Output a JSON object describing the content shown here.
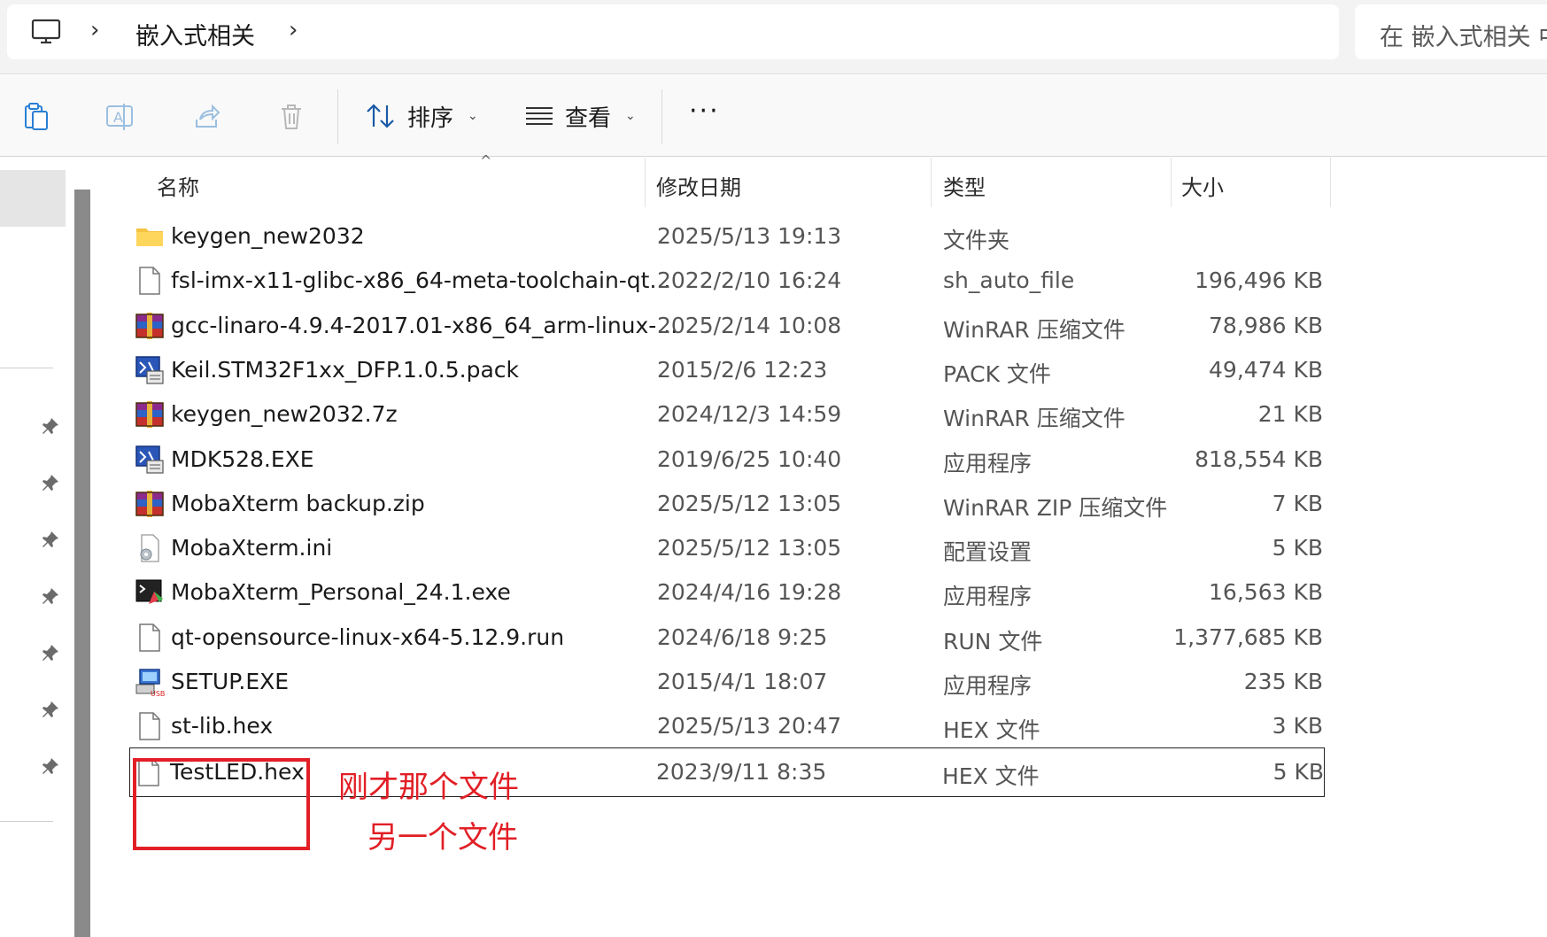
{
  "address": {
    "breadcrumb": "嵌入式相关",
    "search_placeholder": "在 嵌入式相关 中"
  },
  "toolbar": {
    "sort_label": "排序",
    "view_label": "查看",
    "more_label": "···"
  },
  "columns": {
    "name": "名称",
    "date": "修改日期",
    "type": "类型",
    "size": "大小"
  },
  "files": [
    {
      "name": "keygen_new2032",
      "date": "2025/5/13 19:13",
      "type": "文件夹",
      "size": "",
      "icon": "folder-icon"
    },
    {
      "name": "fsl-imx-x11-glibc-x86_64-meta-toolchain-qt...",
      "date": "2022/2/10 16:24",
      "type": "sh_auto_file",
      "size": "196,496 KB",
      "icon": "file-icon"
    },
    {
      "name": "gcc-linaro-4.9.4-2017.01-x86_64_arm-linux-...",
      "date": "2025/2/14 10:08",
      "type": "WinRAR 压缩文件",
      "size": "78,986 KB",
      "icon": "winrar-icon"
    },
    {
      "name": "Keil.STM32F1xx_DFP.1.0.5.pack",
      "date": "2015/2/6 12:23",
      "type": "PACK 文件",
      "size": "49,474 KB",
      "icon": "keil-icon"
    },
    {
      "name": "keygen_new2032.7z",
      "date": "2024/12/3 14:59",
      "type": "WinRAR 压缩文件",
      "size": "21 KB",
      "icon": "winrar-icon"
    },
    {
      "name": "MDK528.EXE",
      "date": "2019/6/25 10:40",
      "type": "应用程序",
      "size": "818,554 KB",
      "icon": "keil-icon"
    },
    {
      "name": "MobaXterm backup.zip",
      "date": "2025/5/12 13:05",
      "type": "WinRAR ZIP 压缩文件",
      "size": "7 KB",
      "icon": "winrar-icon"
    },
    {
      "name": "MobaXterm.ini",
      "date": "2025/5/12 13:05",
      "type": "配置设置",
      "size": "5 KB",
      "icon": "settings-file-icon"
    },
    {
      "name": "MobaXterm_Personal_24.1.exe",
      "date": "2024/4/16 19:28",
      "type": "应用程序",
      "size": "16,563 KB",
      "icon": "mobaxterm-icon"
    },
    {
      "name": "qt-opensource-linux-x64-5.12.9.run",
      "date": "2024/6/18 9:25",
      "type": "RUN 文件",
      "size": "1,377,685 KB",
      "icon": "file-icon"
    },
    {
      "name": "SETUP.EXE",
      "date": "2015/4/1 18:07",
      "type": "应用程序",
      "size": "235 KB",
      "icon": "setup-icon"
    },
    {
      "name": "st-lib.hex",
      "date": "2025/5/13 20:47",
      "type": "HEX 文件",
      "size": "3 KB",
      "icon": "file-icon"
    },
    {
      "name": "TestLED.hex",
      "date": "2023/9/11 8:35",
      "type": "HEX 文件",
      "size": "5 KB",
      "icon": "file-icon"
    }
  ],
  "annotations": {
    "note1": "刚才那个文件",
    "note2": "另一个文件",
    "color": "#e21f26"
  }
}
